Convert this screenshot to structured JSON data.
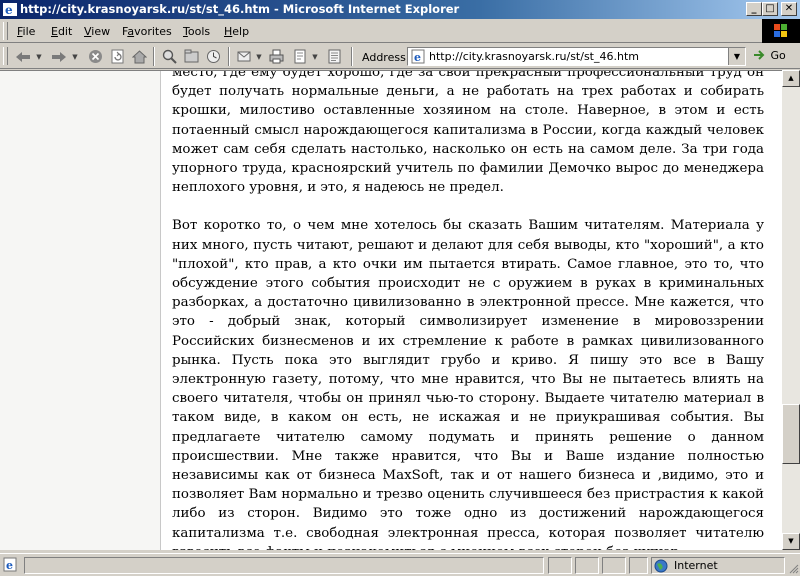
{
  "window": {
    "title": "http://city.krasnoyarsk.ru/st/st_46.htm - Microsoft Internet Explorer",
    "minimize": "_",
    "maximize": "□",
    "close": "✕"
  },
  "menubar": {
    "items": [
      {
        "label": "File",
        "hotkey": "F",
        "rest": "ile"
      },
      {
        "label": "Edit",
        "hotkey": "E",
        "rest": "dit"
      },
      {
        "label": "View",
        "hotkey": "V",
        "rest": "iew"
      },
      {
        "label": "Favorites",
        "hotkey": "a",
        "pre": "F",
        "rest": "vorites"
      },
      {
        "label": "Tools",
        "hotkey": "T",
        "rest": "ools"
      },
      {
        "label": "Help",
        "hotkey": "H",
        "rest": "elp"
      }
    ]
  },
  "toolbar": {
    "icons": [
      "back-icon",
      "forward-icon",
      "stop-icon",
      "refresh-icon",
      "home-icon",
      "search-icon",
      "favorites-icon",
      "history-icon",
      "mail-icon",
      "print-icon",
      "edit-icon",
      "discuss-icon"
    ]
  },
  "address": {
    "label": "Address",
    "label_hotkey": "d",
    "url": "http://city.krasnoyarsk.ru/st/st_46.htm",
    "go_label": "Go"
  },
  "article": {
    "paragraphs": [
      "место, где ему будет хорошо, где за свой прекрасный профессиональный труд он будет получать нормальные деньги, а не работать на трех работах и собирать крошки, милостиво оставленные хозяином на столе. Наверное, в этом и есть потаенный смысл нарождающегося капитализма в России, когда каждый человек может сам себя сделать настолько, насколько он есть на самом деле. За три года упорного труда, красноярский учитель по фамилии Демочко вырос до менеджера неплохого уровня, и это, я надеюсь не предел.",
      "Вот коротко то, о чем мне хотелось бы сказать Вашим читателям. Материала у них много, пусть читают, решают и делают для себя выводы, кто \"хороший\", а кто \"плохой\", кто прав, а кто очки им пытается втирать. Самое главное, это то, что обсуждение этого события происходит не с оружием в руках в криминальных разборках, а достаточно цивилизованно в электронной прессе. Мне кажется, что это - добрый знак, который символизирует изменение в мировоззрении Российских бизнесменов и их стремление к работе в рамках цивилизованного рынка. Пусть пока это выглядит грубо и криво. Я пишу это все в Вашу электронную газету, потому, что мне нравится, что Вы не пытаетесь влиять на своего читателя, чтобы он принял чью-то сторону. Выдаете читателю материал в таком виде, в каком он есть, не искажая и не приукрашивая события. Вы предлагаете читателю самому подумать и принять решение о данном происшествии. Мне также нравится, что Вы и Ваше издание полностью независимы как от бизнеса MaxSoft, так и от нашего бизнеса и ,видимо, это и позволяет Вам нормально и трезво оценить случившееся без пристрастия к какой либо из сторон. Видимо это тоже одно из достижений нарождающегося капитализма т.е. свободная электронная пресса, которая позволяет читателю взвесить все факты и познакомиться с мнением всех сторон без купюр."
    ]
  },
  "scroll": {
    "position_fraction": 0.82
  },
  "status": {
    "zone": "Internet"
  }
}
